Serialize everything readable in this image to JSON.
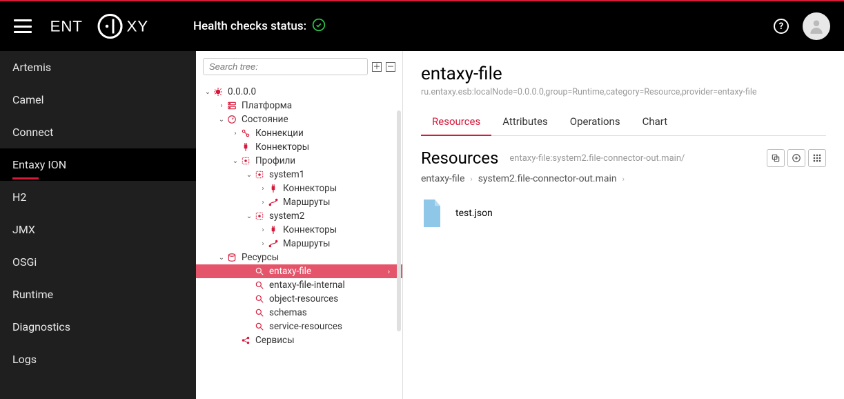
{
  "header": {
    "health_label": "Health checks status:"
  },
  "nav": {
    "items": [
      {
        "label": "Artemis"
      },
      {
        "label": "Camel"
      },
      {
        "label": "Connect"
      },
      {
        "label": "Entaxy ION",
        "active": true
      },
      {
        "label": "H2"
      },
      {
        "label": "JMX"
      },
      {
        "label": "OSGi"
      },
      {
        "label": "Runtime"
      },
      {
        "label": "Diagnostics"
      },
      {
        "label": "Logs"
      }
    ]
  },
  "tree": {
    "search_placeholder": "Search tree:",
    "nodes": {
      "root": "0.0.0.0",
      "platform": "Платформа",
      "state": "Состояние",
      "connections": "Коннекции",
      "connectors": "Коннекторы",
      "profiles": "Профили",
      "system1": "system1",
      "s1_connectors": "Коннекторы",
      "s1_routes": "Маршруты",
      "system2": "system2",
      "s2_connectors": "Коннекторы",
      "s2_routes": "Маршруты",
      "resources": "Ресурсы",
      "r_entaxy_file": "entaxy-file",
      "r_entaxy_file_internal": "entaxy-file-internal",
      "r_object_resources": "object-resources",
      "r_schemas": "schemas",
      "r_service_resources": "service-resources",
      "services": "Сервисы"
    }
  },
  "main": {
    "title": "entaxy-file",
    "subpath": "ru.entaxy.esb:localNode=0.0.0.0,group=Runtime,category=Resource,provider=entaxy-file",
    "tabs": [
      {
        "label": "Resources",
        "active": true
      },
      {
        "label": "Attributes"
      },
      {
        "label": "Operations"
      },
      {
        "label": "Chart"
      }
    ],
    "section_title": "Resources",
    "section_sub": "entaxy-file:system2.file-connector-out.main/",
    "breadcrumb": [
      "entaxy-file",
      "system2.file-connector-out.main"
    ],
    "files": [
      {
        "name": "test.json"
      }
    ]
  }
}
